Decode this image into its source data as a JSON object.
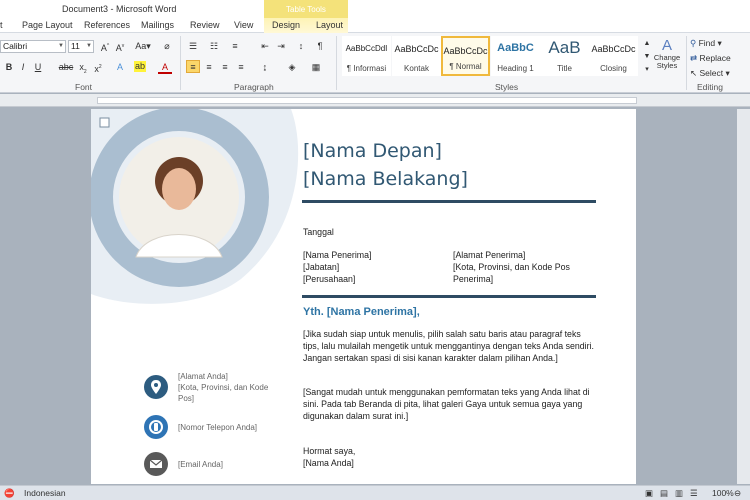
{
  "window": {
    "title": "Document3  -  Microsoft Word",
    "contextual_tab": "Table Tools"
  },
  "ribbon_tabs": [
    "t",
    "Page Layout",
    "References",
    "Mailings",
    "Review",
    "View",
    "Design",
    "Layout"
  ],
  "font": {
    "name": "Calibri",
    "size": "11",
    "group_label": "Font"
  },
  "paragraph": {
    "group_label": "Paragraph"
  },
  "styles": {
    "group_label": "Styles",
    "items": [
      {
        "sample": "AaBbCcDdI",
        "name": "¶ Informasi"
      },
      {
        "sample": "AaBbCcDc",
        "name": "Kontak"
      },
      {
        "sample": "AaBbCcDc",
        "name": "¶ Normal"
      },
      {
        "sample": "AaBbC",
        "name": "Heading 1"
      },
      {
        "sample": "AaB",
        "name": "Title"
      },
      {
        "sample": "AaBbCcDc",
        "name": "Closing"
      }
    ],
    "change_styles": "Change Styles"
  },
  "editing": {
    "group_label": "Editing",
    "find": "Find",
    "replace": "Replace",
    "select": "Select"
  },
  "document": {
    "first_name": "[Nama Depan]",
    "last_name": "[Nama Belakang]",
    "date": "Tanggal",
    "recipient_left": [
      "[Nama Penerima]",
      "[Jabatan]",
      "[Perusahaan]"
    ],
    "recipient_right": [
      "[Alamat Penerima]",
      "[Kota, Provinsi, dan Kode Pos",
      "Penerima]"
    ],
    "salutation": "Yth. [Nama Penerima],",
    "paragraph1": "[Jika sudah siap untuk menulis, pilih salah satu baris atau paragraf teks tips, lalu mulailah mengetik untuk menggantinya dengan teks Anda sendiri. Jangan sertakan spasi di sisi kanan karakter dalam pilihan Anda.]",
    "paragraph2": "[Sangat mudah untuk menggunakan pemformatan teks yang Anda lihat di sini. Pada tab Beranda di pita, lihat galeri Gaya untuk semua gaya yang digunakan dalam surat ini.]",
    "closing": "Hormat saya,",
    "signature": "[Nama Anda]",
    "contact_address": [
      "[Alamat Anda]",
      "[Kota, Provinsi, dan Kode",
      "Pos]"
    ],
    "contact_phone": "[Nomor Telepon Anda]",
    "contact_email": "[Email Anda]"
  },
  "status": {
    "language": "Indonesian",
    "zoom": "100%"
  },
  "colors": {
    "heading": "#315873",
    "accent_rule": "#2e4b63",
    "salutation": "#2e74a4",
    "contact_icon": "#2d5c80",
    "circle_brush": "#9fb5c9"
  }
}
